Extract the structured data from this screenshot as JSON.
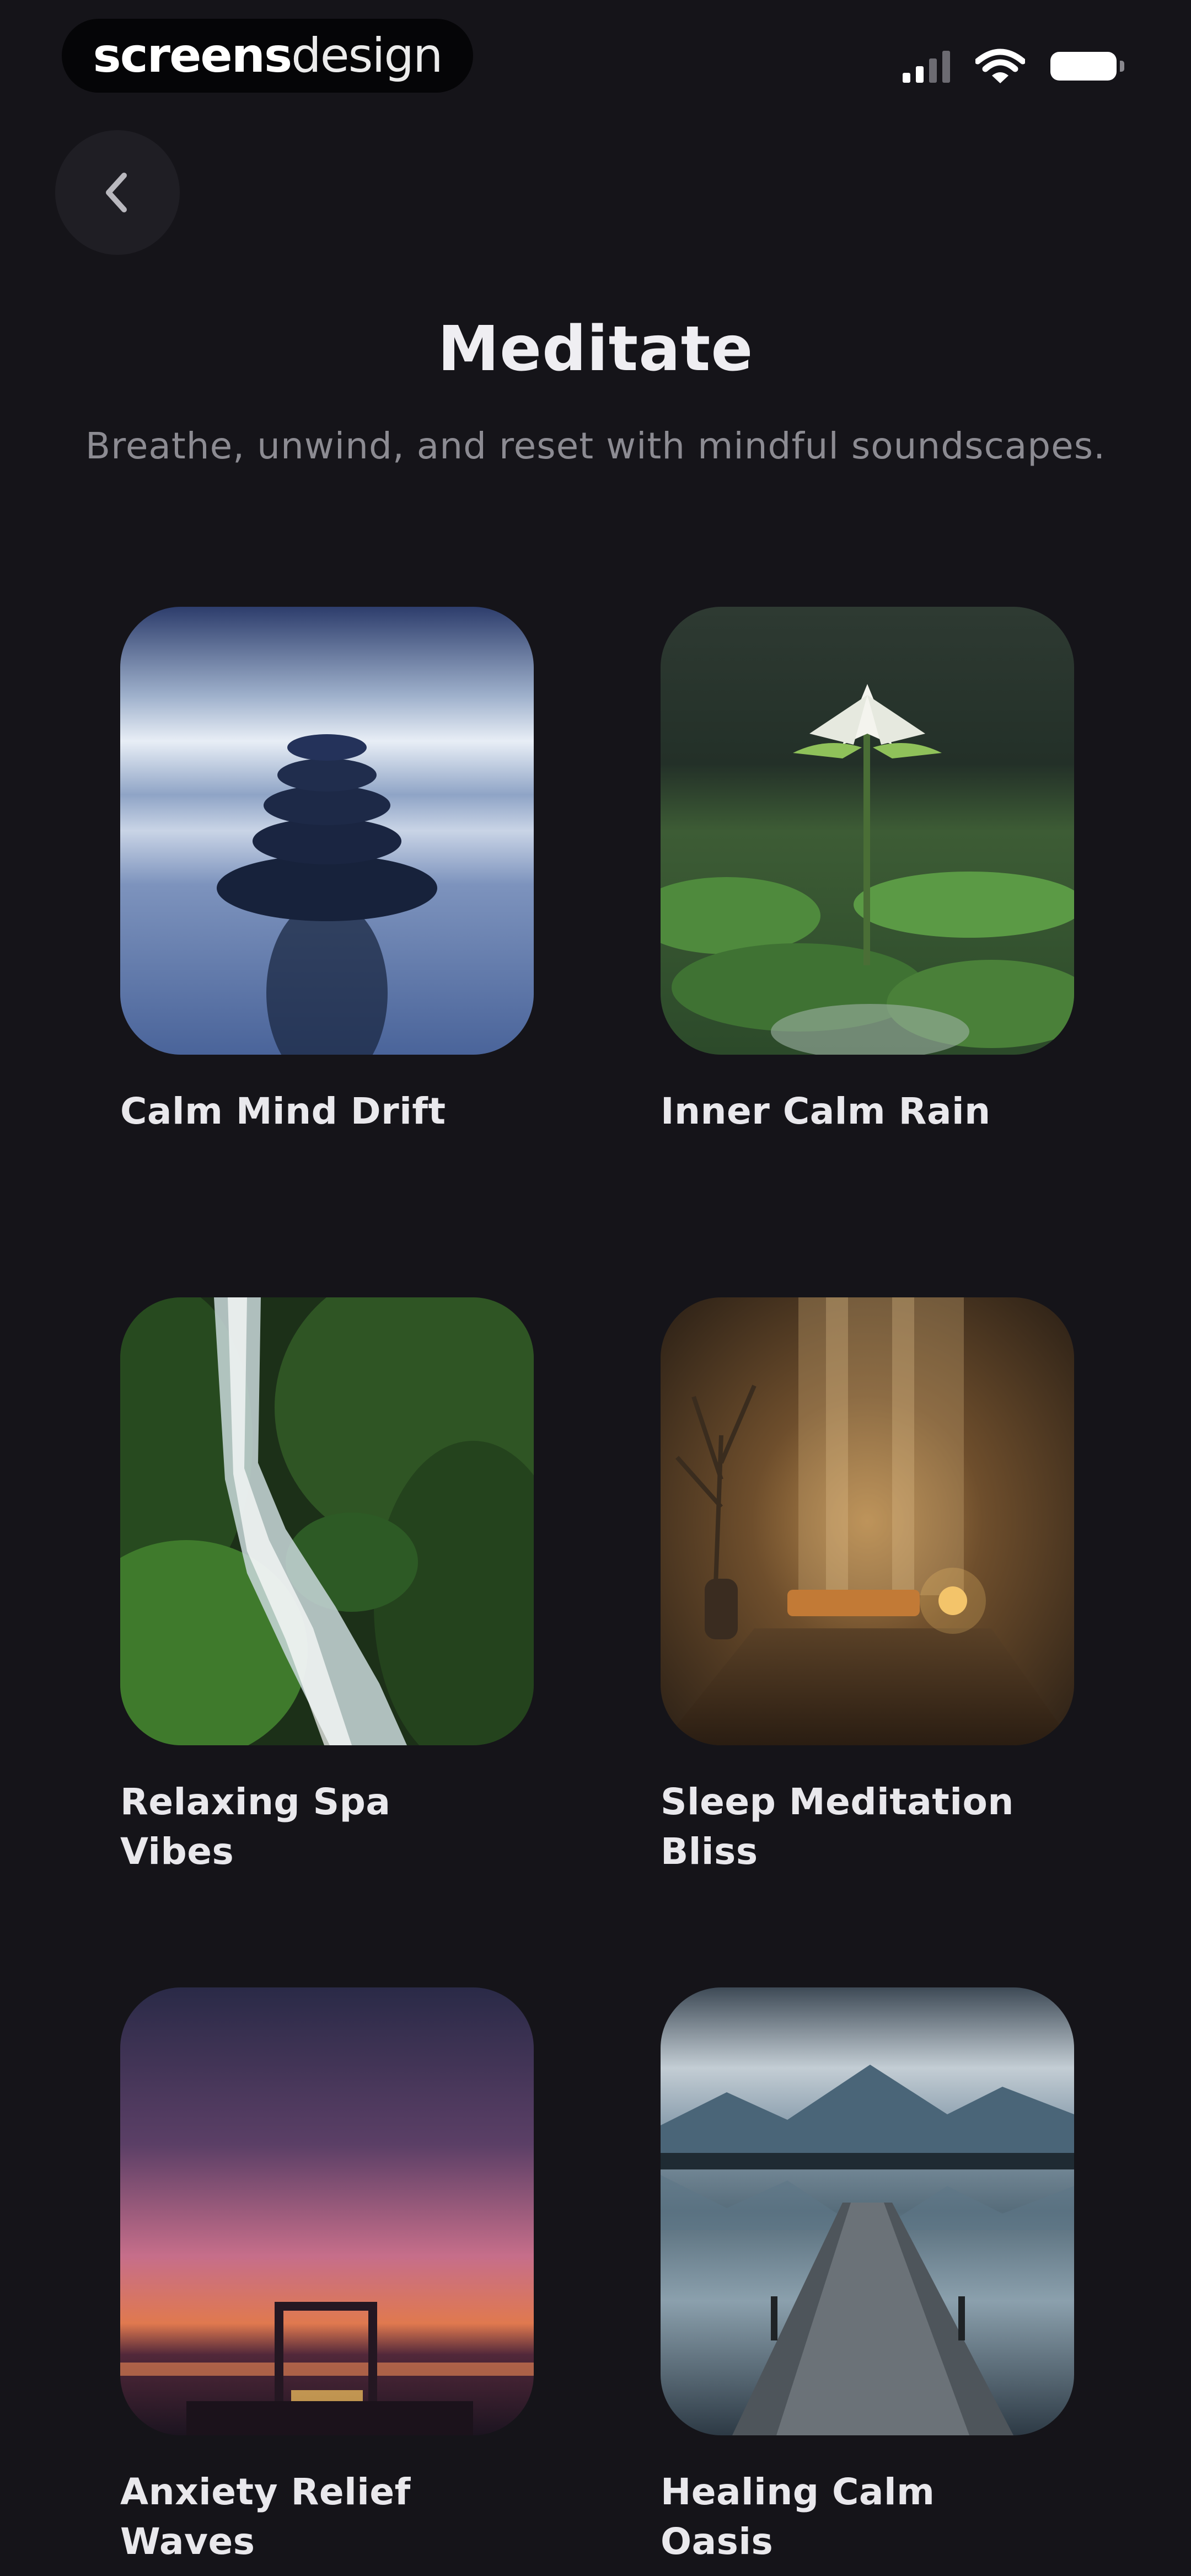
{
  "status_bar": {
    "brand_bold": "screens",
    "brand_light": "design",
    "icons": [
      "cellular-signal-icon",
      "wifi-icon",
      "battery-icon"
    ]
  },
  "header": {
    "back_icon": "chevron-left-icon",
    "title": "Meditate",
    "subtitle": "Breathe, unwind, and reset with mindful soundscapes."
  },
  "sessions": [
    {
      "title": "Calm Mind Drift",
      "image": "stacked-stones-on-water"
    },
    {
      "title": "Inner Calm Rain",
      "image": "white-lotus-on-pond"
    },
    {
      "title": "Relaxing Spa Vibes",
      "image": "forest-waterfall"
    },
    {
      "title": "Sleep Meditation Bliss",
      "image": "candlelit-spa-room"
    },
    {
      "title": "Anxiety Relief Waves",
      "image": "sunset-over-lake"
    },
    {
      "title": "Healing Calm Oasis",
      "image": "lake-pier-with-mountains"
    }
  ],
  "colors": {
    "background": "#151419",
    "text_primary": "#efeef2",
    "text_secondary": "#8c8b92",
    "back_button": "#1f1e24"
  }
}
